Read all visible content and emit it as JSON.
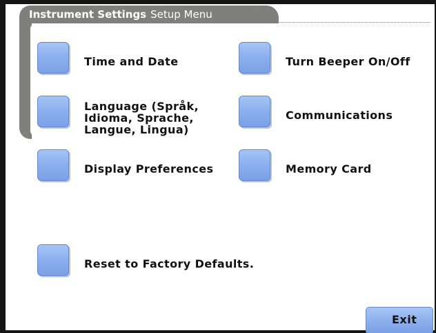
{
  "title": {
    "bold": "Instrument Settings",
    "normal": "Setup Menu"
  },
  "options": {
    "time_date": "Time and Date",
    "beeper": "Turn Beeper On/Off",
    "language": [
      "Language (Språk,",
      "Idioma, Sprache,",
      "Langue, Lingua)"
    ],
    "communications": "Communications",
    "display_prefs": "Display Preferences",
    "memory_card": "Memory Card",
    "reset": "Reset to Factory Defaults."
  },
  "exit_label": "Exit",
  "colors": {
    "button_blue": "#8db1ef",
    "tab_gray": "#7f7f7b",
    "bezel": "#151515"
  }
}
